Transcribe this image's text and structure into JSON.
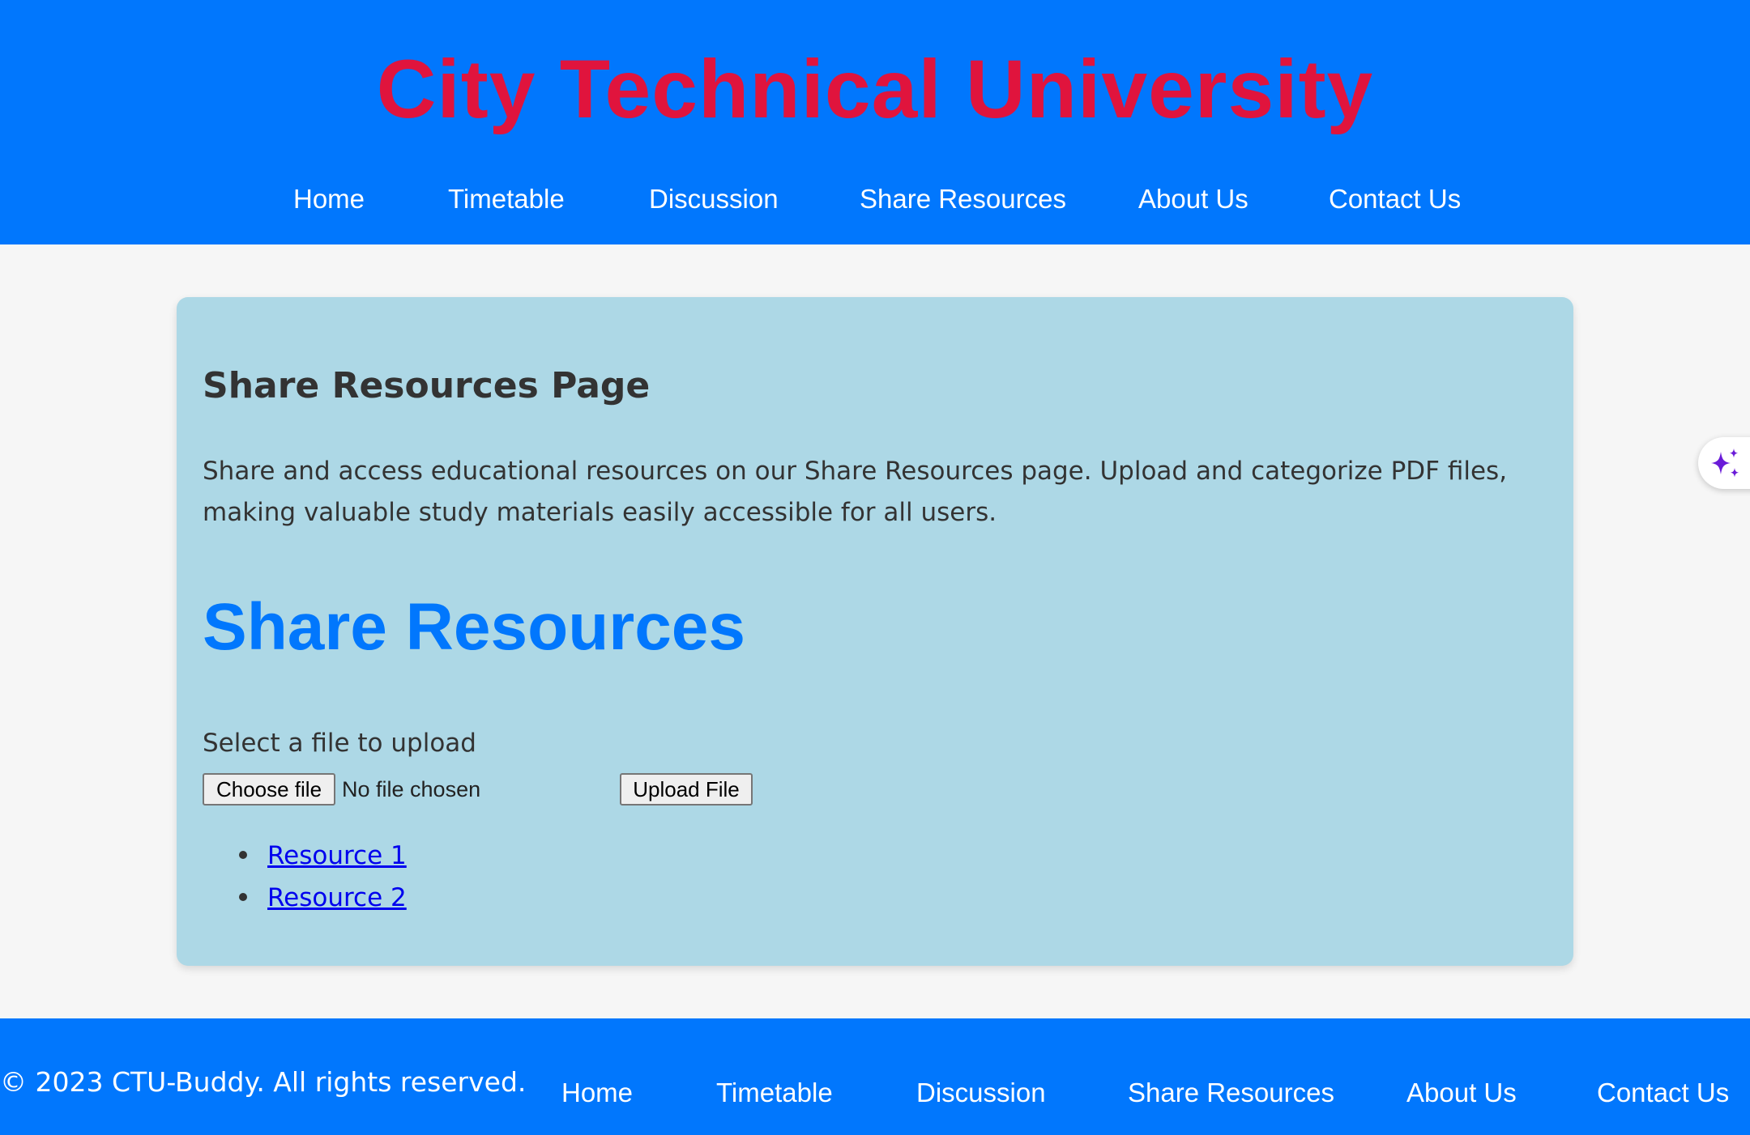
{
  "header": {
    "site_title": "City Technical University",
    "nav": [
      "Home",
      "Timetable",
      "Discussion",
      "Share Resources",
      "About Us",
      "Contact Us"
    ]
  },
  "main": {
    "page_heading": "Share Resources Page",
    "intro": "Share and access educational resources on our Share Resources page. Upload and categorize PDF files, making valuable study materials easily accessible for all users.",
    "section_heading": "Share Resources",
    "upload": {
      "label": "Select a file to upload",
      "choose_button": "Choose file",
      "no_file_text": "No file chosen",
      "upload_button": "Upload File"
    },
    "resources": [
      "Resource 1",
      "Resource 2"
    ]
  },
  "footer": {
    "copyright": "© 2023 CTU-Buddy. All rights reserved.",
    "nav": [
      "Home",
      "Timetable",
      "Discussion",
      "Share Resources",
      "About Us",
      "Contact Us"
    ]
  },
  "floating": {
    "ai_icon": "sparkle-icon"
  },
  "colors": {
    "brand_blue": "#0177fd",
    "title_red": "#e0143d",
    "card_bg": "#add8e6",
    "link": "#0000ee",
    "sparkle": "#6a1bd8"
  }
}
